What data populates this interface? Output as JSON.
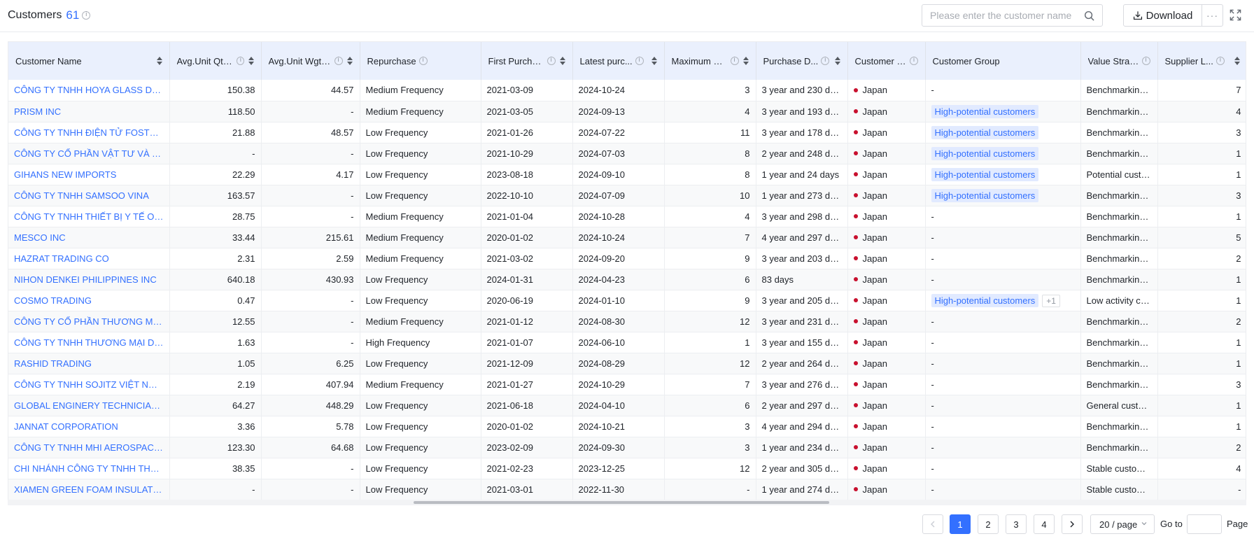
{
  "header": {
    "title": "Customers",
    "count": "61",
    "search_placeholder": "Please enter the customer name",
    "download_label": "Download",
    "more_label": "···"
  },
  "columns": [
    {
      "label": "Customer Name",
      "info": false,
      "sortable": true
    },
    {
      "label": "Avg.Unit Qty P...",
      "info": true,
      "sortable": true
    },
    {
      "label": "Avg.Unit Wgt ...",
      "info": true,
      "sortable": true
    },
    {
      "label": "Repurchase",
      "info": true,
      "sortable": false
    },
    {
      "label": "First Purcha...",
      "info": true,
      "sortable": true
    },
    {
      "label": "Latest purc...",
      "info": true,
      "sortable": true
    },
    {
      "label": "Maximum D...",
      "info": true,
      "sortable": true
    },
    {
      "label": "Purchase D...",
      "info": true,
      "sortable": true
    },
    {
      "label": "Customer L...",
      "info": true,
      "sortable": false
    },
    {
      "label": "Customer Group",
      "info": false,
      "sortable": false
    },
    {
      "label": "Value Strat...",
      "info": true,
      "sortable": false
    },
    {
      "label": "Supplier L...",
      "info": true,
      "sortable": true
    }
  ],
  "rows": [
    {
      "name": "CÔNG TY TNHH HOYA GLASS DISK VIỆT NAM",
      "qty": "150.38",
      "wgt": "44.57",
      "repurchase": "Medium Frequency",
      "first": "2021-03-09",
      "latest": "2024-10-24",
      "maxd": "3",
      "duration": "3 year and 230 days",
      "location": "Japan",
      "groups": [],
      "value": "Benchmarking ...",
      "supplier": "7"
    },
    {
      "name": "PRISM INC",
      "qty": "118.50",
      "wgt": "-",
      "repurchase": "Medium Frequency",
      "first": "2021-03-05",
      "latest": "2024-09-13",
      "maxd": "4",
      "duration": "3 year and 193 days",
      "location": "Japan",
      "groups": [
        "High-potential customers"
      ],
      "value": "Benchmarking ...",
      "supplier": "4"
    },
    {
      "name": "CÔNG TY TNHH ĐIỆN TỬ FOSTER QUẢNG NGÃI",
      "qty": "21.88",
      "wgt": "48.57",
      "repurchase": "Low Frequency",
      "first": "2021-01-26",
      "latest": "2024-07-22",
      "maxd": "11",
      "duration": "3 year and 178 days",
      "location": "Japan",
      "groups": [
        "High-potential customers"
      ],
      "value": "Benchmarking ...",
      "supplier": "3"
    },
    {
      "name": "CÔNG TY CỔ PHẦN VẬT TƯ VÀ TRANG THIẾT BỊ",
      "qty": "-",
      "wgt": "-",
      "repurchase": "Low Frequency",
      "first": "2021-10-29",
      "latest": "2024-07-03",
      "maxd": "8",
      "duration": "2 year and 248 days",
      "location": "Japan",
      "groups": [
        "High-potential customers"
      ],
      "value": "Benchmarking ...",
      "supplier": "1"
    },
    {
      "name": "GIHANS NEW IMPORTS",
      "qty": "22.29",
      "wgt": "4.17",
      "repurchase": "Low Frequency",
      "first": "2023-08-18",
      "latest": "2024-09-10",
      "maxd": "8",
      "duration": "1 year and 24 days",
      "location": "Japan",
      "groups": [
        "High-potential customers"
      ],
      "value": "Potential custo...",
      "supplier": "1"
    },
    {
      "name": "CÔNG TY TNHH SAMSOO VINA",
      "qty": "163.57",
      "wgt": "-",
      "repurchase": "Low Frequency",
      "first": "2022-10-10",
      "latest": "2024-07-09",
      "maxd": "10",
      "duration": "1 year and 273 days",
      "location": "Japan",
      "groups": [
        "High-potential customers"
      ],
      "value": "Benchmarking ...",
      "supplier": "3"
    },
    {
      "name": "CÔNG TY TNHH THIẾT BỊ Y TẾ OLYMPUS VIỆT NAM",
      "qty": "28.75",
      "wgt": "-",
      "repurchase": "Medium Frequency",
      "first": "2021-01-04",
      "latest": "2024-10-28",
      "maxd": "4",
      "duration": "3 year and 298 days",
      "location": "Japan",
      "groups": [],
      "value": "Benchmarking ...",
      "supplier": "1"
    },
    {
      "name": "MESCO INC",
      "qty": "33.44",
      "wgt": "215.61",
      "repurchase": "Medium Frequency",
      "first": "2020-01-02",
      "latest": "2024-10-24",
      "maxd": "7",
      "duration": "4 year and 297 days",
      "location": "Japan",
      "groups": [],
      "value": "Benchmarking ...",
      "supplier": "5"
    },
    {
      "name": "HAZRAT TRADING CO",
      "qty": "2.31",
      "wgt": "2.59",
      "repurchase": "Medium Frequency",
      "first": "2021-03-02",
      "latest": "2024-09-20",
      "maxd": "9",
      "duration": "3 year and 203 days",
      "location": "Japan",
      "groups": [],
      "value": "Benchmarking ...",
      "supplier": "2"
    },
    {
      "name": "NIHON DENKEI PHILIPPINES INC",
      "qty": "640.18",
      "wgt": "430.93",
      "repurchase": "Low Frequency",
      "first": "2024-01-31",
      "latest": "2024-04-23",
      "maxd": "6",
      "duration": "83 days",
      "location": "Japan",
      "groups": [],
      "value": "Benchmarking ...",
      "supplier": "1"
    },
    {
      "name": "COSMO TRADING",
      "qty": "0.47",
      "wgt": "-",
      "repurchase": "Low Frequency",
      "first": "2020-06-19",
      "latest": "2024-01-10",
      "maxd": "9",
      "duration": "3 year and 205 days",
      "location": "Japan",
      "groups": [
        "High-potential customers"
      ],
      "extra": "+1",
      "value": "Low activity cu...",
      "supplier": "1"
    },
    {
      "name": "CÔNG TY CỔ PHẦN THƯƠNG MẠI VÀ DỊCH VỤ",
      "qty": "12.55",
      "wgt": "-",
      "repurchase": "Medium Frequency",
      "first": "2021-01-12",
      "latest": "2024-08-30",
      "maxd": "12",
      "duration": "3 year and 231 days",
      "location": "Japan",
      "groups": [],
      "value": "Benchmarking ...",
      "supplier": "2"
    },
    {
      "name": "CÔNG TY TNHH THƯƠNG MẠI DỊCH VỤ",
      "qty": "1.63",
      "wgt": "-",
      "repurchase": "High Frequency",
      "first": "2021-01-07",
      "latest": "2024-06-10",
      "maxd": "1",
      "duration": "3 year and 155 days",
      "location": "Japan",
      "groups": [],
      "value": "Benchmarking ...",
      "supplier": "1"
    },
    {
      "name": "RASHID TRADING",
      "qty": "1.05",
      "wgt": "6.25",
      "repurchase": "Low Frequency",
      "first": "2021-12-09",
      "latest": "2024-08-29",
      "maxd": "12",
      "duration": "2 year and 264 days",
      "location": "Japan",
      "groups": [],
      "value": "Benchmarking ...",
      "supplier": "1"
    },
    {
      "name": "CÔNG TY TNHH SOJITZ VIỆT NAM CHI NHÁNH",
      "qty": "2.19",
      "wgt": "407.94",
      "repurchase": "Medium Frequency",
      "first": "2021-01-27",
      "latest": "2024-10-29",
      "maxd": "7",
      "duration": "3 year and 276 days",
      "location": "Japan",
      "groups": [],
      "value": "Benchmarking ...",
      "supplier": "3"
    },
    {
      "name": "GLOBAL ENGINERY TECHNICIANS INC",
      "qty": "64.27",
      "wgt": "448.29",
      "repurchase": "Low Frequency",
      "first": "2021-06-18",
      "latest": "2024-04-10",
      "maxd": "6",
      "duration": "2 year and 297 days",
      "location": "Japan",
      "groups": [],
      "value": "General custom...",
      "supplier": "1"
    },
    {
      "name": "JANNAT CORPORATION",
      "qty": "3.36",
      "wgt": "5.78",
      "repurchase": "Low Frequency",
      "first": "2020-01-02",
      "latest": "2024-10-21",
      "maxd": "3",
      "duration": "4 year and 294 days",
      "location": "Japan",
      "groups": [],
      "value": "Benchmarking ...",
      "supplier": "1"
    },
    {
      "name": "CÔNG TY TNHH MHI AEROSPACE VIỆT NAM",
      "qty": "123.30",
      "wgt": "64.68",
      "repurchase": "Low Frequency",
      "first": "2023-02-09",
      "latest": "2024-09-30",
      "maxd": "3",
      "duration": "1 year and 234 days",
      "location": "Japan",
      "groups": [],
      "value": "Benchmarking ...",
      "supplier": "2"
    },
    {
      "name": "CHI NHÁNH CÔNG TY TNHH THORESEN VINAMA",
      "qty": "38.35",
      "wgt": "-",
      "repurchase": "Low Frequency",
      "first": "2021-02-23",
      "latest": "2023-12-25",
      "maxd": "12",
      "duration": "2 year and 305 days",
      "location": "Japan",
      "groups": [],
      "value": "Stable customers",
      "supplier": "4"
    },
    {
      "name": "XIAMEN GREEN FOAM INSULATION MATERIAL",
      "qty": "-",
      "wgt": "-",
      "repurchase": "Low Frequency",
      "first": "2021-03-01",
      "latest": "2022-11-30",
      "maxd": "-",
      "duration": "1 year and 274 days",
      "location": "Japan",
      "groups": [],
      "value": "Stable customers",
      "supplier": "-"
    }
  ],
  "empty_value": "-",
  "pagination": {
    "prev": "<",
    "next": ">",
    "pages": [
      "1",
      "2",
      "3",
      "4"
    ],
    "current": "1",
    "page_size": "20 / page",
    "goto_label": "Go to",
    "page_label": "Page"
  },
  "colors": {
    "accent": "#3370ff",
    "header_bg": "#eaf0fd",
    "tag_bg": "#e1eaff",
    "flag_dot": "#c8102e"
  }
}
